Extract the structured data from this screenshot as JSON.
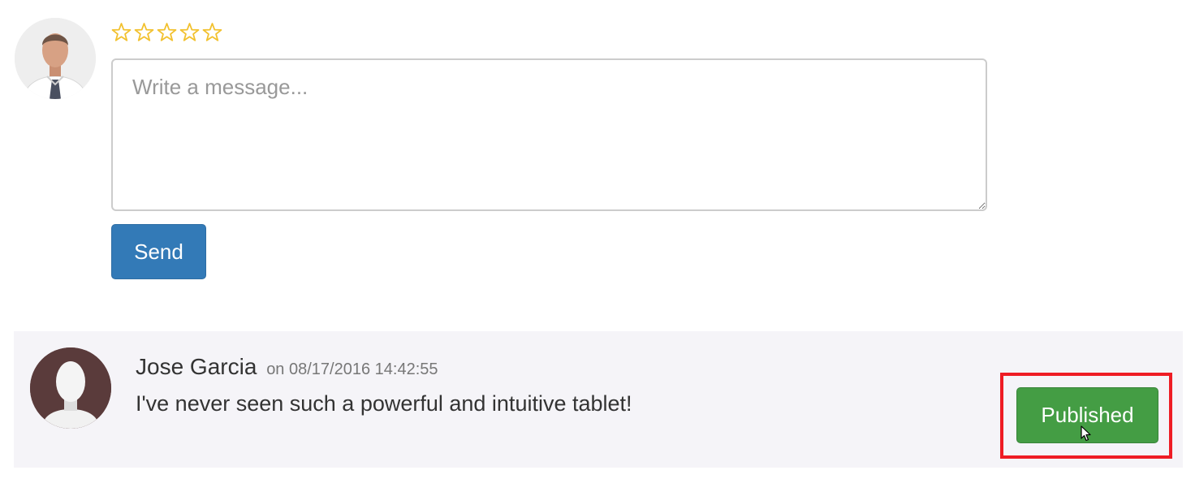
{
  "composer": {
    "rating": {
      "max": 5,
      "value": 0,
      "color": "#f2c12e"
    },
    "message": {
      "placeholder": "Write a message...",
      "value": ""
    },
    "send_label": "Send"
  },
  "review": {
    "author": "Jose Garcia",
    "date": "on 08/17/2016 14:42:55",
    "text": "I've never seen such a powerful and intuitive tablet!",
    "status_label": "Published",
    "status_color": "#449d44",
    "highlight_color": "#ee1c24"
  }
}
